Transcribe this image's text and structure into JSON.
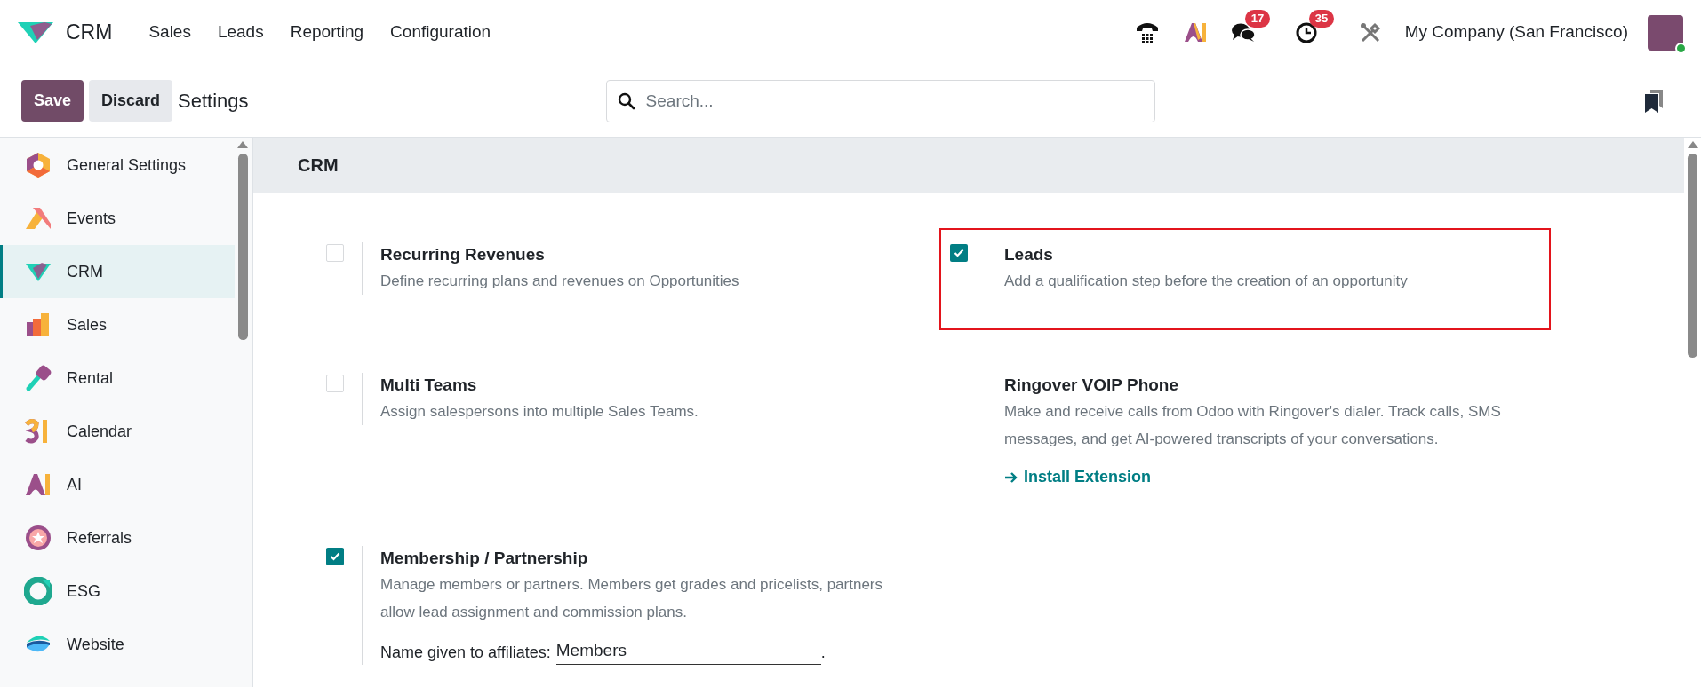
{
  "navbar": {
    "app_name": "CRM",
    "menu": [
      "Sales",
      "Leads",
      "Reporting",
      "Configuration"
    ],
    "badges": [
      {
        "kind": "phone"
      },
      {
        "kind": "ai"
      },
      {
        "kind": "chat",
        "count": "17"
      },
      {
        "kind": "clock",
        "count": "35"
      },
      {
        "kind": "tools"
      }
    ],
    "company": "My Company (San Francisco)"
  },
  "control_panel": {
    "buttons": [
      {
        "label": "Save",
        "kind": "primary"
      },
      {
        "label": "Discard",
        "kind": "secondary"
      }
    ],
    "title": "Settings",
    "search": {
      "placeholder": "Search..."
    }
  },
  "sidebar": {
    "items": [
      {
        "label": "General Settings",
        "selected": false
      },
      {
        "label": "Events",
        "selected": false
      },
      {
        "label": "CRM",
        "selected": true
      },
      {
        "label": "Sales",
        "selected": false
      },
      {
        "label": "Rental",
        "selected": false
      },
      {
        "label": "Calendar",
        "selected": false
      },
      {
        "label": "AI",
        "selected": false
      },
      {
        "label": "Referrals",
        "selected": false
      },
      {
        "label": "ESG",
        "selected": false
      },
      {
        "label": "Website",
        "selected": false
      }
    ]
  },
  "section": {
    "title": "CRM",
    "settings": [
      {
        "kind": "checkbox",
        "title": "Recurring Revenues",
        "description": "Define recurring plans and revenues on Opportunities",
        "checked": false,
        "highlighted": false
      },
      {
        "kind": "checkbox",
        "title": "Leads",
        "description": "Add a qualification step before the creation of an opportunity",
        "checked": true,
        "highlighted": true
      },
      {
        "kind": "checkbox",
        "title": "Multi Teams",
        "description": "Assign salespersons into multiple Sales Teams.",
        "checked": false,
        "highlighted": false
      },
      {
        "kind": "extension",
        "title": "Ringover VOIP Phone",
        "description": "Make and receive calls from Odoo with Ringover's dialer. Track calls, SMS messages, and get AI-powered transcripts of your conversations.",
        "link": "Install Extension",
        "highlighted": false
      },
      {
        "kind": "checkbox",
        "title": "Membership / Partnership",
        "description": "Manage members or partners. Members get grades and pricelists, partners allow lead assignment and commission plans.",
        "checked": true,
        "highlighted": false,
        "field": {
          "label": "Name given to affiliates:",
          "value": "Members",
          "suffix": "."
        }
      }
    ]
  }
}
